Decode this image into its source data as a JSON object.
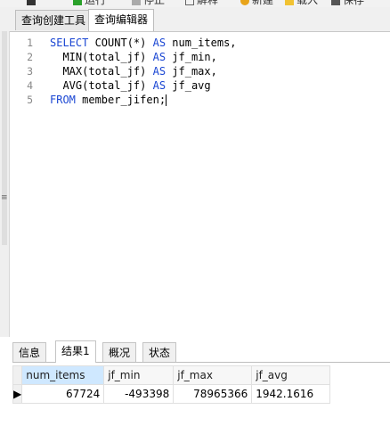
{
  "toolbar": {
    "run": "运行",
    "stop": "停止",
    "explain": "解释",
    "new": "新建",
    "load": "载入",
    "save": "保存"
  },
  "editor_tabs": {
    "builder": "查询创建工具",
    "editor": "查询编辑器"
  },
  "editor": {
    "line_numbers": [
      "1",
      "2",
      "3",
      "4",
      "5"
    ]
  },
  "result_tabs": {
    "info": "信息",
    "result1": "结果1",
    "overview": "概况",
    "status": "状态"
  },
  "grid": {
    "columns": [
      "num_items",
      "jf_min",
      "jf_max",
      "jf_avg"
    ],
    "row": [
      "67724",
      "-493398",
      "78965366",
      "1942.1616"
    ]
  },
  "colors": {
    "keyword": "#1a46d3",
    "selected_header": "#cfe8ff"
  }
}
